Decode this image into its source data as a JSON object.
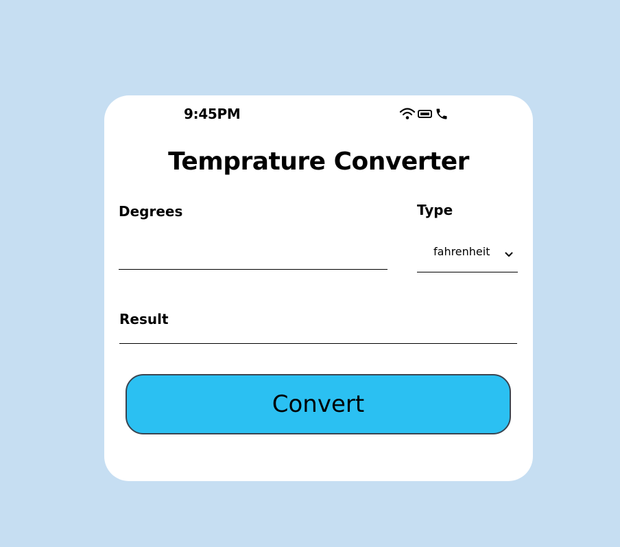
{
  "status_bar": {
    "time": "9:45PM",
    "icons": [
      "wifi-icon",
      "battery-icon",
      "phone-icon"
    ]
  },
  "title": "Temprature Converter",
  "degrees": {
    "label": "Degrees",
    "value": "",
    "placeholder": ""
  },
  "type": {
    "label": "Type",
    "selected": "fahrenheit"
  },
  "result": {
    "label": "Result",
    "value": ""
  },
  "convert_label": "Convert",
  "colors": {
    "background": "#c6def2",
    "card": "#ffffff",
    "button": "#2bc0f2"
  }
}
